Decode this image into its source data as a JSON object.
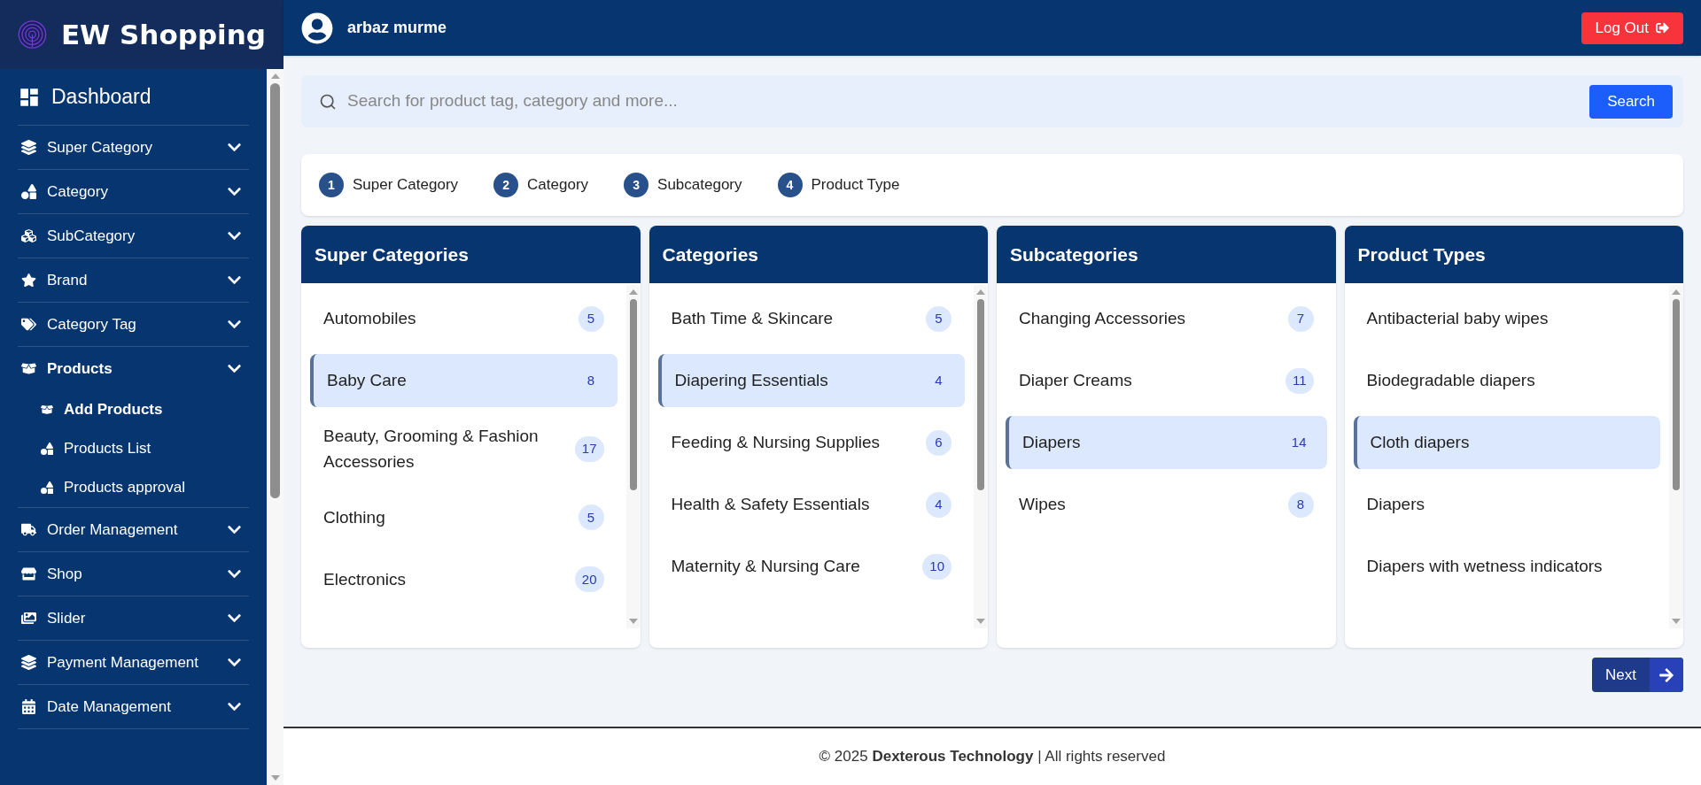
{
  "brand": "EW Shopping",
  "sidebar": {
    "dashboard": "Dashboard",
    "items": [
      {
        "label": "Super Category",
        "expanded": false
      },
      {
        "label": "Category",
        "expanded": false
      },
      {
        "label": "SubCategory",
        "expanded": false
      },
      {
        "label": "Brand",
        "expanded": false
      },
      {
        "label": "Category Tag",
        "expanded": false
      },
      {
        "label": "Products",
        "expanded": true,
        "children": [
          {
            "label": "Add Products",
            "selected": true
          },
          {
            "label": "Products List",
            "selected": false
          },
          {
            "label": "Products approval",
            "selected": false
          }
        ]
      },
      {
        "label": "Order Management",
        "expanded": false
      },
      {
        "label": "Shop",
        "expanded": false
      },
      {
        "label": "Slider",
        "expanded": false
      },
      {
        "label": "Payment Management",
        "expanded": false
      },
      {
        "label": "Date Management",
        "expanded": false
      }
    ]
  },
  "user": "arbaz murme",
  "logout": "Log Out",
  "search": {
    "placeholder": "Search for product tag, category and more...",
    "button": "Search"
  },
  "steps": [
    {
      "number": "1",
      "label": "Super Category"
    },
    {
      "number": "2",
      "label": "Category"
    },
    {
      "number": "3",
      "label": "Subcategory"
    },
    {
      "number": "4",
      "label": "Product Type"
    }
  ],
  "columns": [
    {
      "title": "Super Categories",
      "scrollable": true,
      "items": [
        {
          "label": "Automobiles",
          "count": "5",
          "selected": false
        },
        {
          "label": "Baby Care",
          "count": "8",
          "selected": true
        },
        {
          "label": "Beauty, Grooming & Fashion Accessories",
          "count": "17",
          "selected": false
        },
        {
          "label": "Clothing",
          "count": "5",
          "selected": false
        },
        {
          "label": "Electronics",
          "count": "20",
          "selected": false
        }
      ]
    },
    {
      "title": "Categories",
      "scrollable": true,
      "items": [
        {
          "label": "Bath Time & Skincare",
          "count": "5",
          "selected": false
        },
        {
          "label": "Diapering Essentials",
          "count": "4",
          "selected": true
        },
        {
          "label": "Feeding & Nursing Supplies",
          "count": "6",
          "selected": false
        },
        {
          "label": "Health & Safety Essentials",
          "count": "4",
          "selected": false
        },
        {
          "label": "Maternity & Nursing Care",
          "count": "10",
          "selected": false
        }
      ]
    },
    {
      "title": "Subcategories",
      "scrollable": false,
      "items": [
        {
          "label": "Changing Accessories",
          "count": "7",
          "selected": false
        },
        {
          "label": "Diaper Creams",
          "count": "11",
          "selected": false
        },
        {
          "label": "Diapers",
          "count": "14",
          "selected": true
        },
        {
          "label": "Wipes",
          "count": "8",
          "selected": false
        }
      ]
    },
    {
      "title": "Product Types",
      "scrollable": true,
      "items": [
        {
          "label": "Antibacterial baby wipes",
          "selected": false
        },
        {
          "label": "Biodegradable diapers",
          "selected": false
        },
        {
          "label": "Cloth diapers",
          "selected": true
        },
        {
          "label": "Diapers",
          "selected": false
        },
        {
          "label": "Diapers with wetness indicators",
          "selected": false
        }
      ]
    }
  ],
  "next": "Next",
  "footer": "© 2025 **Dexterous Technology** | All rights reserved"
}
